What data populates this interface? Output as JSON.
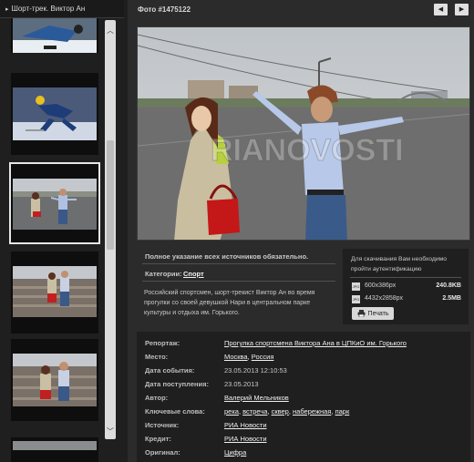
{
  "sidebar": {
    "title": "Шорт-трек. Виктор Ан"
  },
  "header": {
    "photo_id": "Фото #1475122",
    "prev_icon": "triangle-left",
    "next_icon": "triangle-right"
  },
  "photo": {
    "watermark": "RIANOVOSTI"
  },
  "source_note": "Полное указание всех источников обязательно.",
  "category": {
    "label": "Категории:",
    "value": "Спорт"
  },
  "caption": "Российский спортсмен, шорт-трекист Виктор Ан во время прогулки со своей девушкой Нари в центральном парке культуры и отдыха им. Горького.",
  "download": {
    "note": "Для скачивания Вам необходимо пройти аутентификацию",
    "items": [
      {
        "dims": "600x386px",
        "size": "240.8KB"
      },
      {
        "dims": "4432x2858px",
        "size": "2.5MB"
      }
    ],
    "print_label": "Печать"
  },
  "meta": {
    "reportage_label": "Репортаж:",
    "reportage": "Прогулка спортсмена Виктора Ана в ЦПКиО им. Горького",
    "place_label": "Место:",
    "place": [
      "Москва",
      "Россия"
    ],
    "event_date_label": "Дата события:",
    "event_date": "23.05.2013 12:10:53",
    "received_label": "Дата поступления:",
    "received": "23.05.2013",
    "author_label": "Автор:",
    "author": "Валерий Мельников",
    "keywords_label": "Ключевые слова:",
    "keywords": [
      "река",
      "встреча",
      "сквер",
      "набережная",
      "парк"
    ],
    "source_label": "Источник:",
    "source": "РИА Новости",
    "credit_label": "Кредит:",
    "credit": "РИА Новости",
    "original_label": "Оригинал:",
    "original": "Цифра"
  }
}
